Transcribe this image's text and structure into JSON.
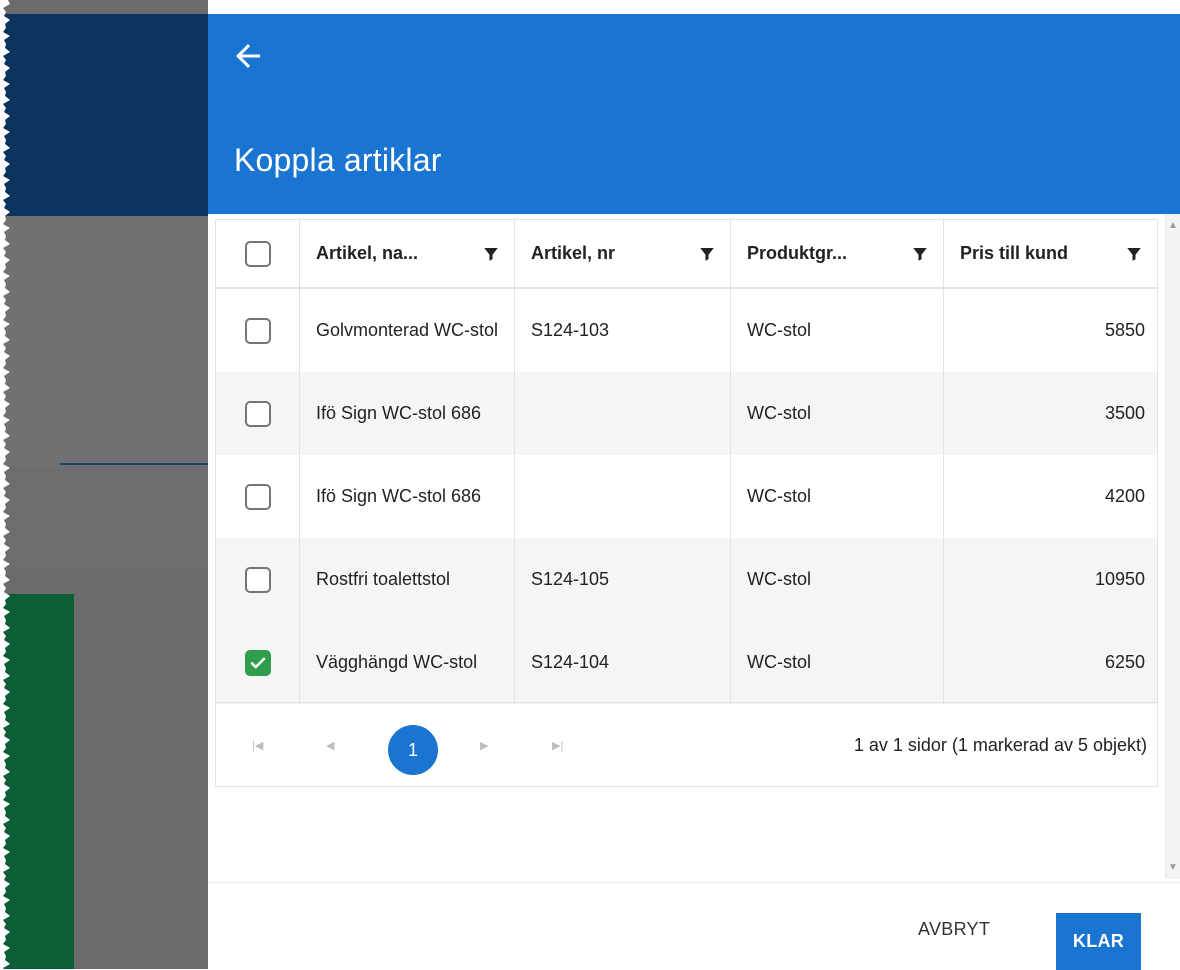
{
  "dialog": {
    "title": "Koppla artiklar",
    "back_icon": "arrow-left-icon"
  },
  "table": {
    "columns": [
      "Artikel, na...",
      "Artikel, nr",
      "Produktgr...",
      "Pris till kund"
    ],
    "rows": [
      {
        "name": "Golvmonterad WC-stol",
        "number": "S124-103",
        "group": "WC-stol",
        "price": "5850",
        "checked": false
      },
      {
        "name": "Ifö Sign WC-stol 686",
        "number": "",
        "group": "WC-stol",
        "price": "3500",
        "checked": false
      },
      {
        "name": "Ifö Sign WC-stol 686",
        "number": "",
        "group": "WC-stol",
        "price": "4200",
        "checked": false
      },
      {
        "name": "Rostfri toalettstol",
        "number": "S124-105",
        "group": "WC-stol",
        "price": "10950",
        "checked": false
      },
      {
        "name": "Vägghängd WC-stol",
        "number": "S124-104",
        "group": "WC-stol",
        "price": "6250",
        "checked": true
      }
    ]
  },
  "pager": {
    "current_page": "1",
    "info": "1 av 1 sidor (1 markerad av 5 objekt)"
  },
  "footer": {
    "cancel_label": "AVBRYT",
    "ok_label": "KLAR"
  },
  "colors": {
    "primary": "#1a75d2",
    "check_green": "#2e9e4d",
    "sidebar_navy": "#0b335e",
    "sidebar_green": "#0d5e36"
  }
}
